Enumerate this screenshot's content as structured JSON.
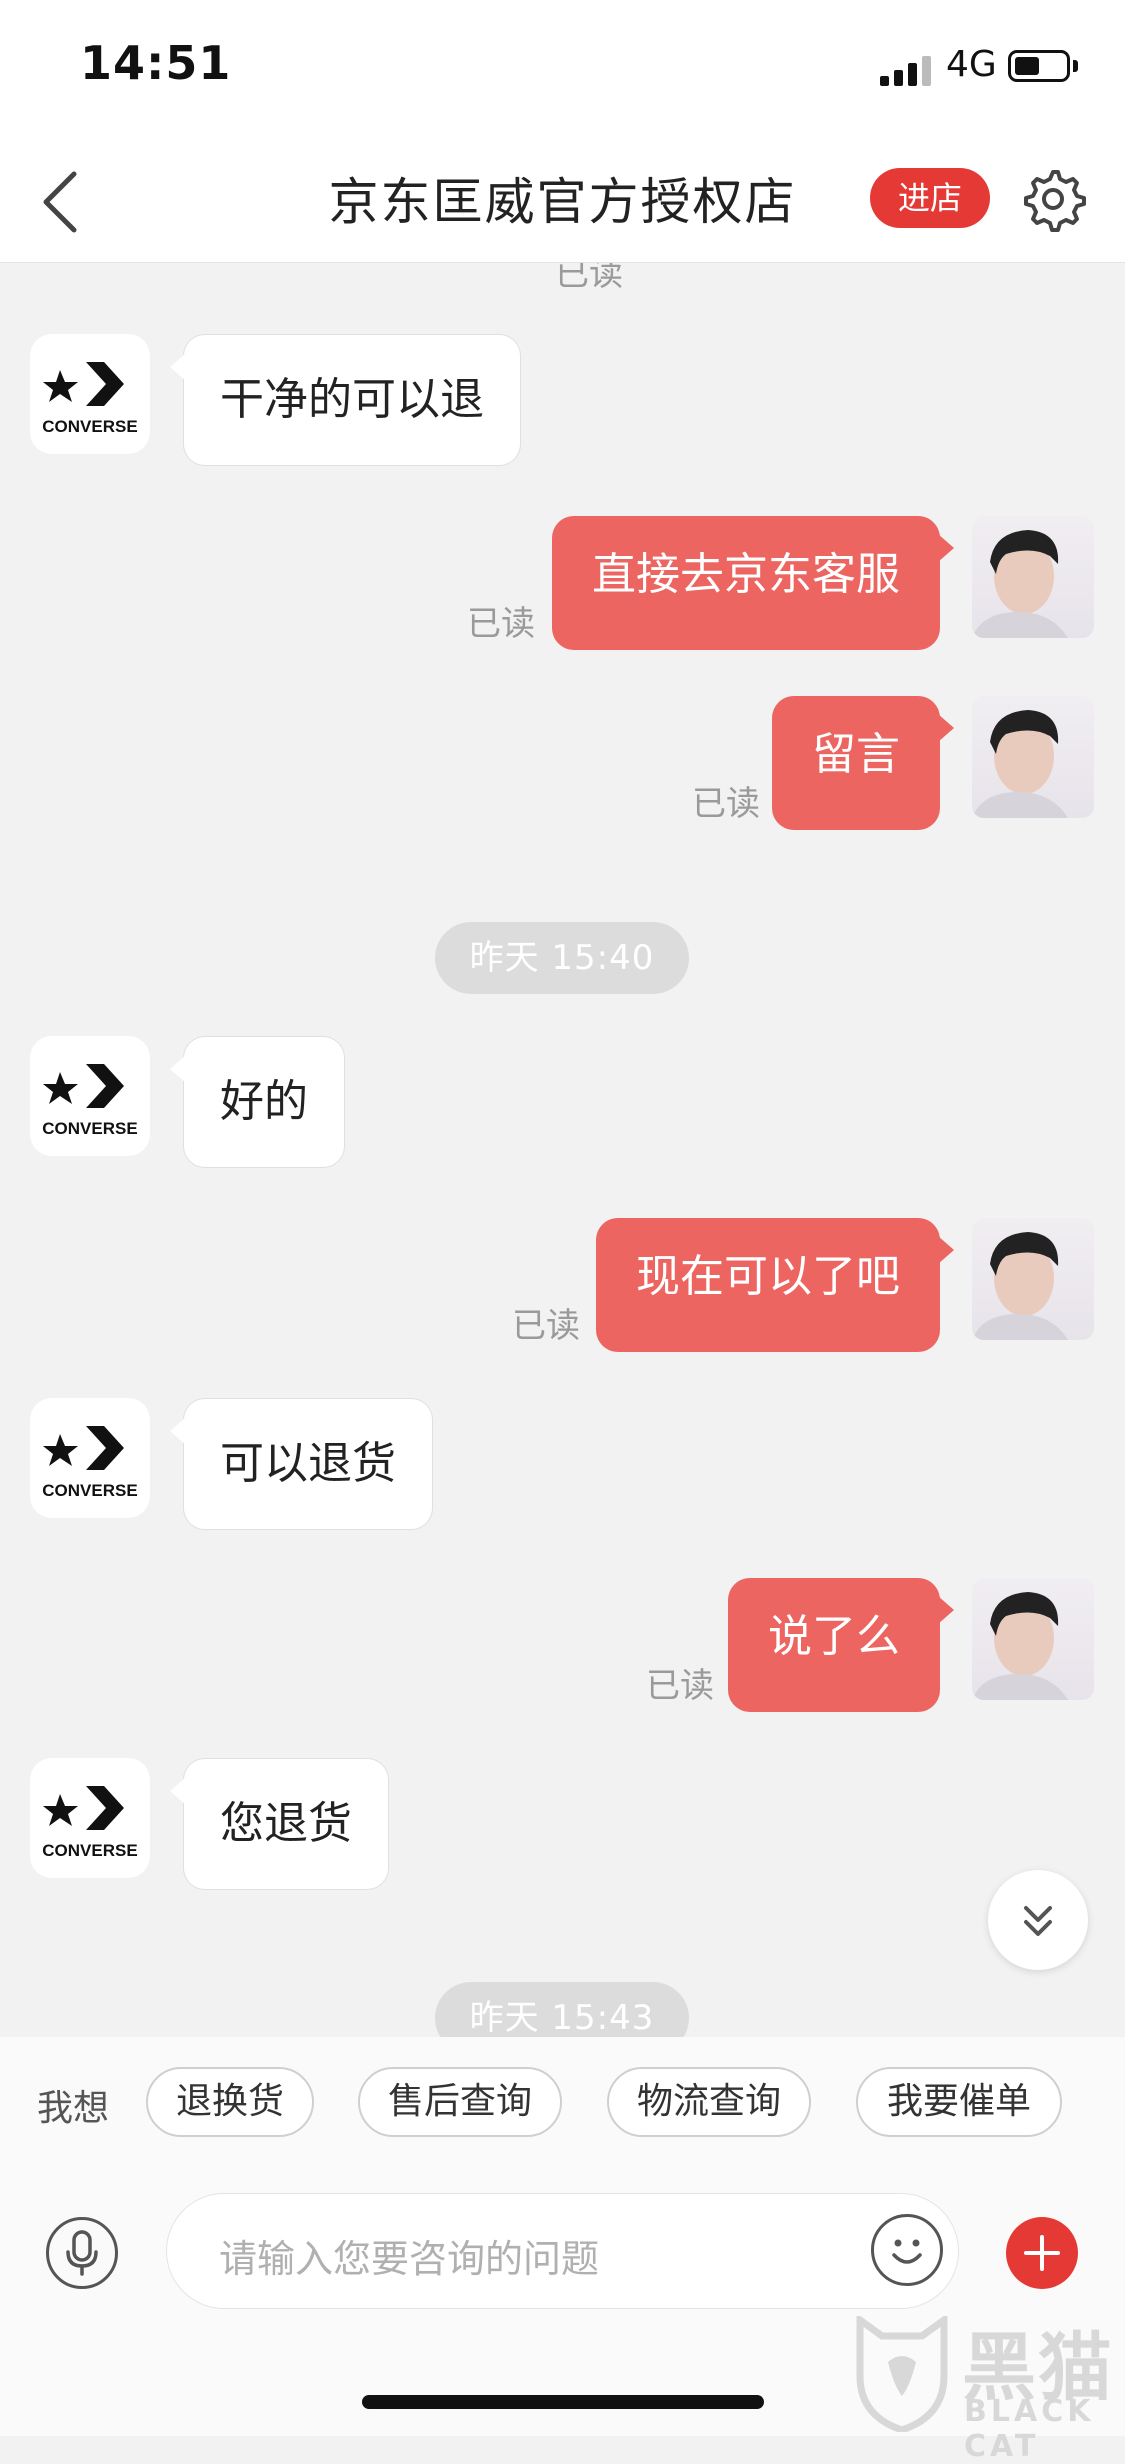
{
  "status": {
    "time": "14:51",
    "network": "4G"
  },
  "header": {
    "title": "京东匡威官方授权店",
    "shop_button": "进店"
  },
  "messages": [
    {
      "from": "shop",
      "text": "干净的可以退"
    },
    {
      "from": "user",
      "text": "直接去京东客服",
      "status": "已读"
    },
    {
      "from": "user",
      "text": "留言",
      "status": "已读"
    },
    {
      "type": "time",
      "text": "昨天 15:40"
    },
    {
      "from": "shop",
      "text": "好的"
    },
    {
      "from": "user",
      "text": "现在可以了吧",
      "status": "已读"
    },
    {
      "from": "shop",
      "text": "可以退货"
    },
    {
      "from": "user",
      "text": "说了么",
      "status": "已读"
    },
    {
      "from": "shop",
      "text": "您退货"
    },
    {
      "type": "time",
      "text": "昨天 15:43"
    }
  ],
  "top_partial": {
    "status": "已读"
  },
  "shop_logo_text": "CONVERSE",
  "quick_replies": {
    "label": "我想",
    "items": [
      "退换货",
      "售后查询",
      "物流查询",
      "我要催单"
    ]
  },
  "input": {
    "placeholder": "请输入您要咨询的问题"
  },
  "watermark": {
    "brand": "黑猫",
    "sub": "BLACK CAT"
  },
  "colors": {
    "accent": "#e53935",
    "out_bubble": "#ec6561",
    "background": "#f2f2f2"
  }
}
